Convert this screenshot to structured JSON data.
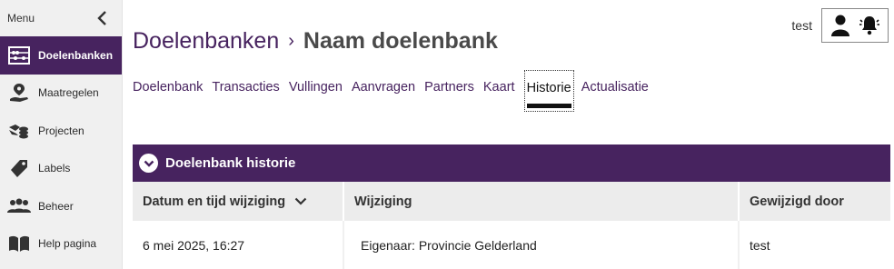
{
  "sidebar": {
    "menu_label": "Menu",
    "items": [
      {
        "label": "Doelenbanken",
        "icon": "abacus-icon",
        "active": true
      },
      {
        "label": "Maatregelen",
        "icon": "map-pin-hand-icon",
        "active": false
      },
      {
        "label": "Projecten",
        "icon": "coins-hand-icon",
        "active": false
      },
      {
        "label": "Labels",
        "icon": "tag-icon",
        "active": false
      },
      {
        "label": "Beheer",
        "icon": "users-icon",
        "active": false
      },
      {
        "label": "Help pagina",
        "icon": "book-icon",
        "active": false
      }
    ]
  },
  "header": {
    "user_name": "test"
  },
  "breadcrumb": {
    "parent": "Doelenbanken",
    "separator": "›",
    "current": "Naam doelenbank"
  },
  "tabs": [
    {
      "label": "Doelenbank"
    },
    {
      "label": "Transacties"
    },
    {
      "label": "Vullingen"
    },
    {
      "label": "Aanvragen"
    },
    {
      "label": "Partners"
    },
    {
      "label": "Kaart"
    },
    {
      "label": "Historie",
      "active": true
    },
    {
      "label": "Actualisatie"
    }
  ],
  "panel": {
    "title": "Doelenbank historie",
    "columns": [
      "Datum en tijd wijziging",
      "Wijziging",
      "Gewijzigd door"
    ],
    "rows": [
      {
        "date": "6 mei 2025, 16:27",
        "change": "Eigenaar: Provincie Gelderland",
        "by": "test"
      }
    ]
  },
  "colors": {
    "brand": "#47235f",
    "header_bg": "#ececec"
  }
}
